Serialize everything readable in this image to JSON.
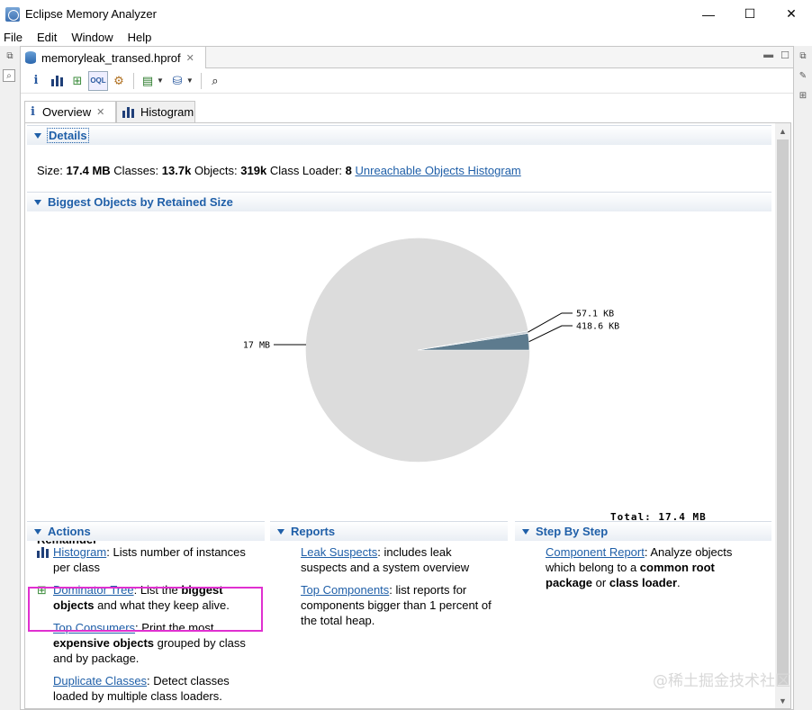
{
  "window": {
    "title": "Eclipse Memory Analyzer",
    "minimize": "—",
    "maximize": "☐",
    "close": "✕"
  },
  "menu": [
    "File",
    "Edit",
    "Window",
    "Help"
  ],
  "editor_tab": {
    "label": "memoryleak_transed.hprof"
  },
  "inner_tabs": {
    "overview": "Overview",
    "histogram": "Histogram"
  },
  "details": {
    "header": "Details",
    "size_label": "Size:",
    "size_value": "17.4 MB",
    "classes_label": "Classes:",
    "classes_value": "13.7k",
    "objects_label": "Objects:",
    "objects_value": "319k",
    "loader_label": "Class Loader:",
    "loader_value": "8",
    "unreachable_link": "Unreachable Objects Histogram"
  },
  "biggest": {
    "header": "Biggest Objects by Retained Size"
  },
  "chart_data": {
    "type": "pie",
    "slices": [
      {
        "label": "17 MB",
        "value": 17.0,
        "color": "#dcdcdc"
      },
      {
        "label": "57.1 KB",
        "value": 0.0571,
        "color": "#dcdcdc"
      },
      {
        "label": "418.6 KB",
        "value": 0.4186,
        "color": "#5d7b8e"
      }
    ],
    "total_label": "Total: 17.4 MB",
    "remainder_label": "Remainder"
  },
  "actions": {
    "header": "Actions",
    "items": [
      {
        "link": "Histogram",
        "text": ": Lists number of instances per class"
      },
      {
        "link": "Dominator Tree",
        "text_a": ": List the ",
        "bold": "biggest objects",
        "text_b": " and what they keep alive."
      },
      {
        "link": "Top Consumers",
        "text_a": ": Print the most ",
        "bold": "expensive objects",
        "text_b": " grouped by class and by package."
      },
      {
        "link": "Duplicate Classes",
        "text": ": Detect classes loaded by multiple class loaders."
      }
    ]
  },
  "reports": {
    "header": "Reports",
    "items": [
      {
        "link": "Leak Suspects",
        "text": ": includes leak suspects and a system overview"
      },
      {
        "link": "Top Components",
        "text": ": list reports for components bigger than 1 percent of the total heap."
      }
    ]
  },
  "step": {
    "header": "Step By Step",
    "link": "Component Report",
    "text_a": ": Analyze objects which belong to a ",
    "bold_a": "common root package",
    "text_b": " or ",
    "bold_b": "class loader",
    "text_c": "."
  },
  "watermark": "@稀土掘金技术社区"
}
